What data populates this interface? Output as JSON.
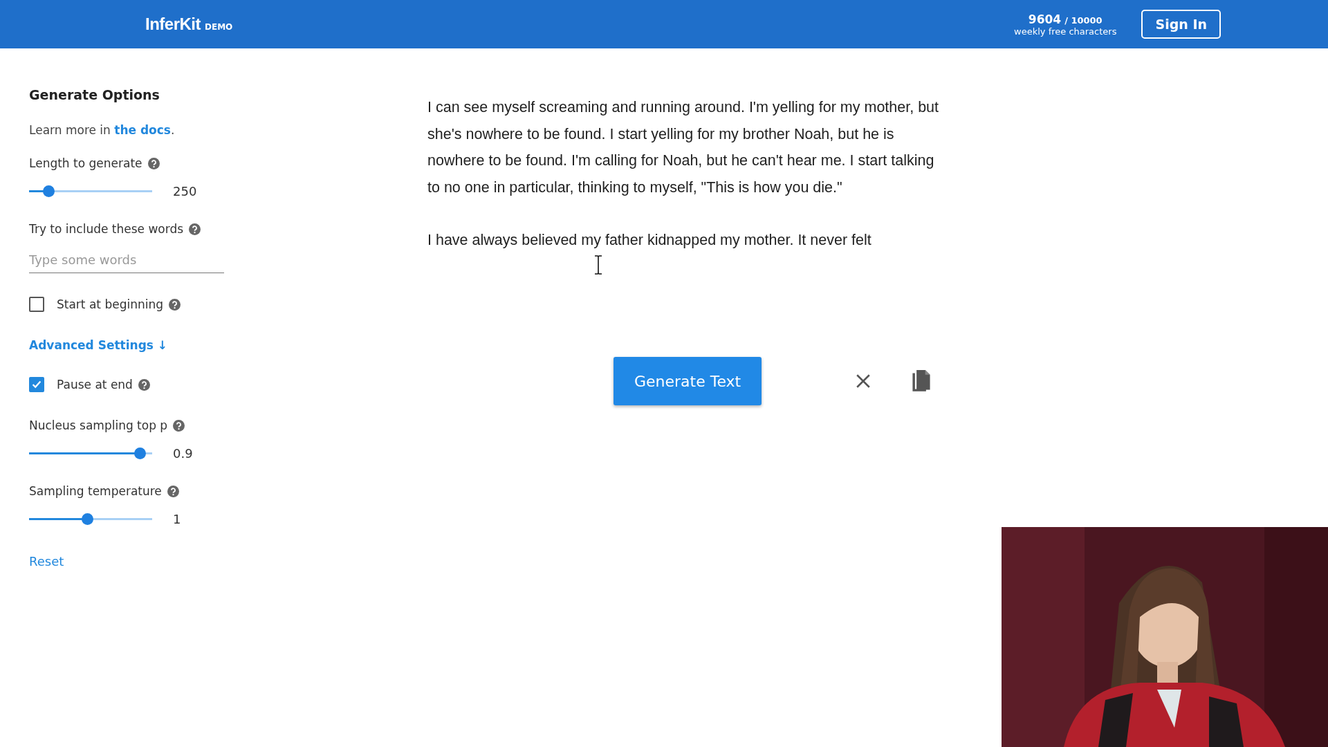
{
  "header": {
    "logo": "InferKit",
    "logo_badge": "DEMO",
    "usage": {
      "used": "9604",
      "total": "/ 10000",
      "caption": "weekly free characters"
    },
    "sign_in": "Sign In"
  },
  "sidebar": {
    "title": "Generate Options",
    "learn_more": {
      "text": "Learn more in ",
      "link": "the docs",
      "after": "."
    },
    "items": [
      {
        "kind": "slider",
        "label": "Length to generate",
        "help": true,
        "level": 0.16,
        "reading": "250"
      },
      {
        "kind": "input",
        "label": "Try to include these words",
        "help": true,
        "placeholder": "Type some words"
      },
      {
        "kind": "checkbox",
        "label": "Start at beginning",
        "help": true,
        "checked": false
      },
      {
        "kind": "toggle",
        "label": "Advanced Settings",
        "arrow": "↓"
      },
      {
        "kind": "checkbox",
        "label": "Pause at end",
        "help": true,
        "checked": true
      },
      {
        "kind": "slider",
        "label": "Nucleus sampling top p",
        "help": true,
        "level": 0.9,
        "reading": "0.9"
      },
      {
        "kind": "slider",
        "label": "Sampling temperature",
        "help": true,
        "level": 0.47,
        "reading": "1"
      }
    ],
    "reset": "Reset"
  },
  "editor": {
    "paragraphs": [
      "I can see myself screaming and running around. I'm yelling for my mother, but she's nowhere to be found. I start yelling for my brother Noah, but he is nowhere to be found. I'm calling for Noah, but he can't hear me. I start talking to no one in particular, thinking to myself, \"This is how you die.\"",
      "I have always believed my father kidnapped my mother. It never felt"
    ]
  },
  "actions": {
    "generate": "Generate Text"
  }
}
